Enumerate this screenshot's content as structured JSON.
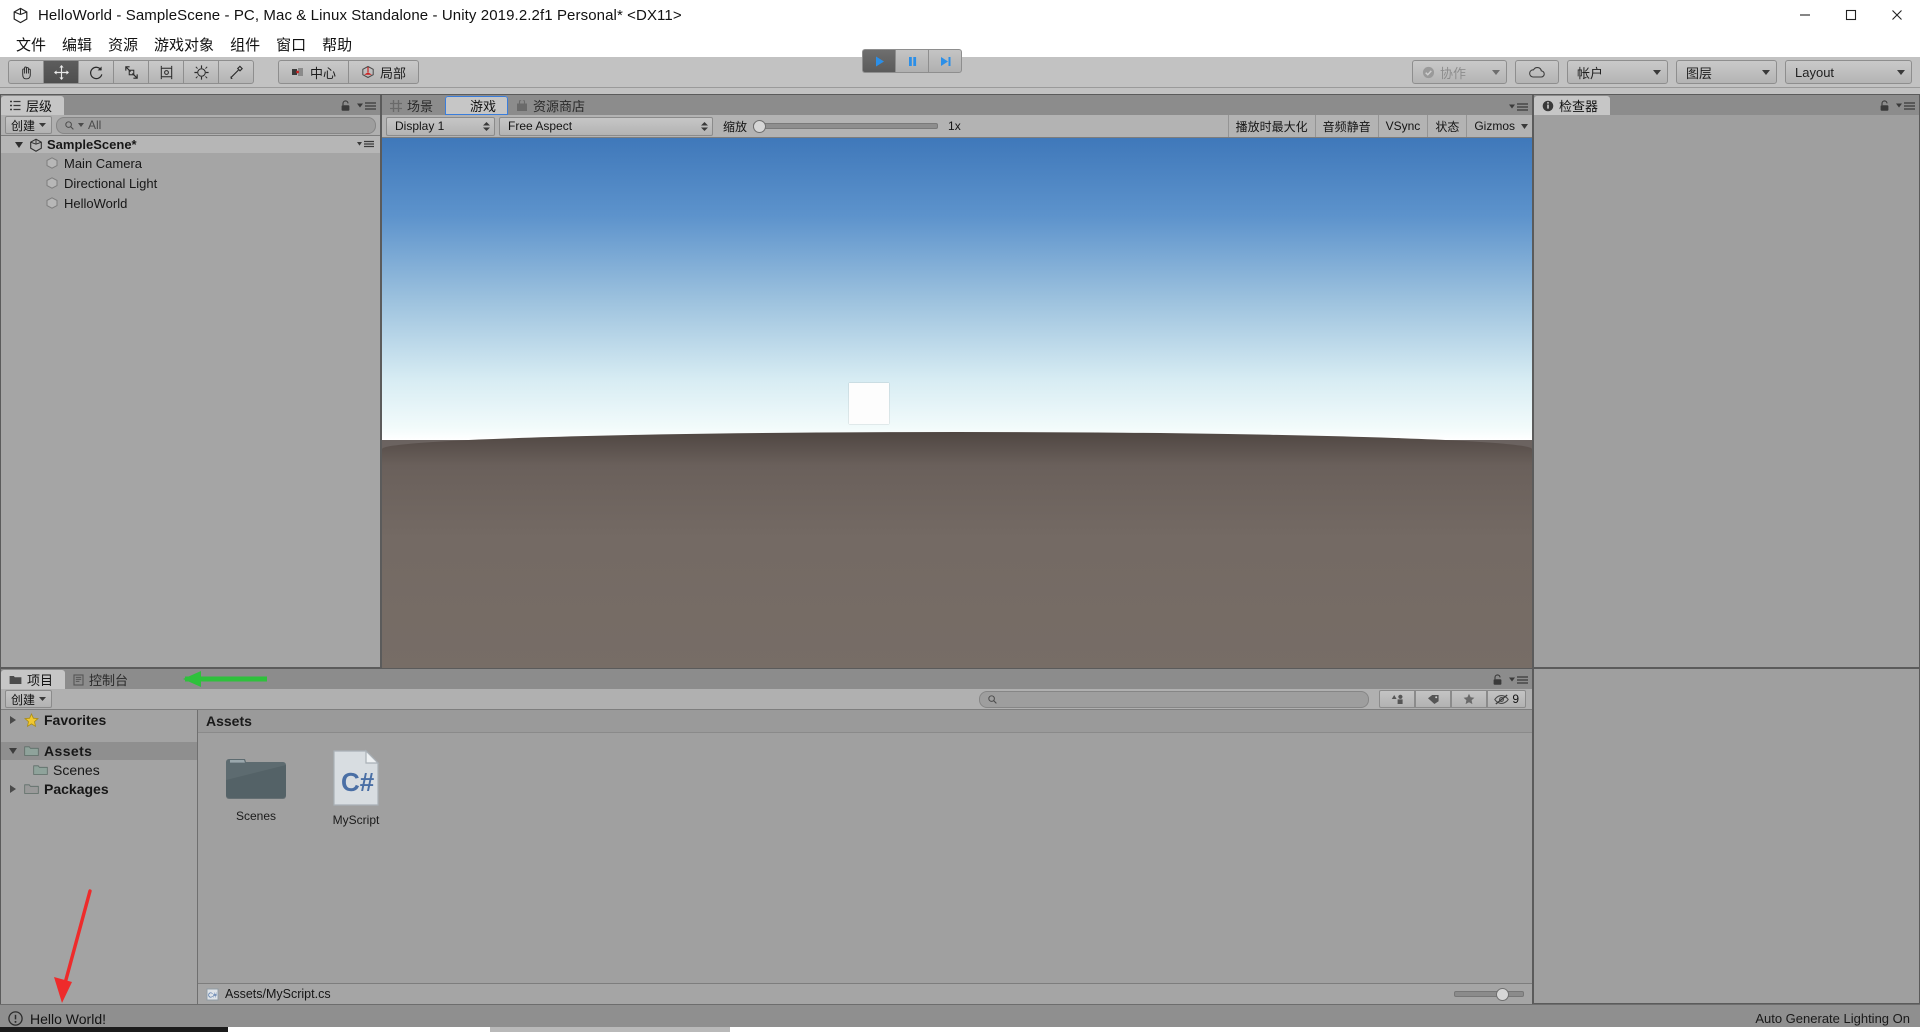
{
  "window": {
    "title": "HelloWorld - SampleScene - PC, Mac & Linux Standalone - Unity 2019.2.2f1 Personal* <DX11>",
    "app_icon": "unity-icon",
    "minimize": "minimize-icon",
    "maximize": "maximize-icon",
    "close": "close-icon"
  },
  "menu": {
    "items": [
      {
        "label": "文件"
      },
      {
        "label": "编辑"
      },
      {
        "label": "资源"
      },
      {
        "label": "游戏对象"
      },
      {
        "label": "组件"
      },
      {
        "label": "窗口"
      },
      {
        "label": "帮助"
      }
    ]
  },
  "toolbar": {
    "tools": [
      {
        "name": "hand-tool",
        "selected": false
      },
      {
        "name": "move-tool",
        "selected": true
      },
      {
        "name": "rotate-tool",
        "selected": false
      },
      {
        "name": "scale-tool",
        "selected": false
      },
      {
        "name": "rect-tool",
        "selected": false
      },
      {
        "name": "transform-tool",
        "selected": false
      },
      {
        "name": "custom-tool",
        "selected": false
      }
    ],
    "pivot_label": "中心",
    "space_label": "局部",
    "play": "play-icon",
    "pause": "pause-icon",
    "step": "step-icon",
    "collab_label": "协作",
    "cloud_label": "cloud-icon",
    "account_label": "帐户",
    "layers_label": "图层",
    "layout_label": "Layout"
  },
  "hierarchy": {
    "tab_label": "层级",
    "create_label": "创建",
    "search_placeholder": "All",
    "scene_name": "SampleScene*",
    "objects": [
      {
        "label": "Main Camera"
      },
      {
        "label": "Directional Light"
      },
      {
        "label": "HelloWorld"
      }
    ]
  },
  "center": {
    "tabs": [
      {
        "label": "场景",
        "icon": "grid-icon",
        "active": false
      },
      {
        "label": "游戏",
        "icon": "gamepad-icon",
        "active": true
      },
      {
        "label": "资源商店",
        "icon": "store-icon",
        "active": false
      }
    ],
    "display_label": "Display 1",
    "aspect_label": "Free Aspect",
    "scale_label": "缩放",
    "scale_value": "1x",
    "maximize_on_play": "播放时最大化",
    "mute_audio": "音频静音",
    "vsync": "VSync",
    "stats": "状态",
    "gizmos": "Gizmos"
  },
  "inspector": {
    "tab_label": "检查器",
    "icon": "info-icon"
  },
  "project": {
    "tabs": [
      {
        "label": "项目",
        "icon": "folder-icon",
        "active": true
      },
      {
        "label": "控制台",
        "icon": "console-icon",
        "active": false
      }
    ],
    "create_label": "创建",
    "search_placeholder": "",
    "tree": [
      {
        "label": "Favorites",
        "icon": "star-icon",
        "bold": true,
        "indent": 0,
        "twisty": "right",
        "selected": false
      },
      {
        "label": "Assets",
        "icon": "folder-open-icon",
        "bold": true,
        "indent": 0,
        "twisty": "down",
        "selected": true
      },
      {
        "label": "Scenes",
        "icon": "folder-icon",
        "bold": false,
        "indent": 1,
        "twisty": "none",
        "selected": false
      },
      {
        "label": "Packages",
        "icon": "folder-icon",
        "bold": true,
        "indent": 0,
        "twisty": "right",
        "selected": false
      }
    ],
    "assets_header": "Assets",
    "items": [
      {
        "label": "Scenes",
        "type": "folder"
      },
      {
        "label": "MyScript",
        "type": "csharp",
        "badge": "C#"
      }
    ],
    "filter_icons": [
      {
        "name": "filter-type-icon"
      },
      {
        "name": "filter-label-icon"
      },
      {
        "name": "filter-favorite-icon"
      },
      {
        "name": "filter-hidden-icon",
        "count": "9"
      }
    ],
    "path": "Assets/MyScript.cs",
    "path_icon": "csharp-file-icon"
  },
  "status": {
    "icon": "info-icon",
    "message": "Hello World!",
    "right_message": "Auto Generate Lighting On"
  },
  "annotations": [
    {
      "name": "green-arrow-annotation",
      "color": "#2ec13c",
      "direction": "left"
    },
    {
      "name": "red-arrow-annotation",
      "color": "#ee2b2b",
      "direction": "down-left"
    }
  ],
  "colors": {
    "accent_blue": "#2b8fe8",
    "panel_bg": "#a5a5a5",
    "toolbar_bg": "#c2c2c2",
    "green_arrow": "#2ec13c",
    "red_arrow": "#ee2b2b"
  }
}
